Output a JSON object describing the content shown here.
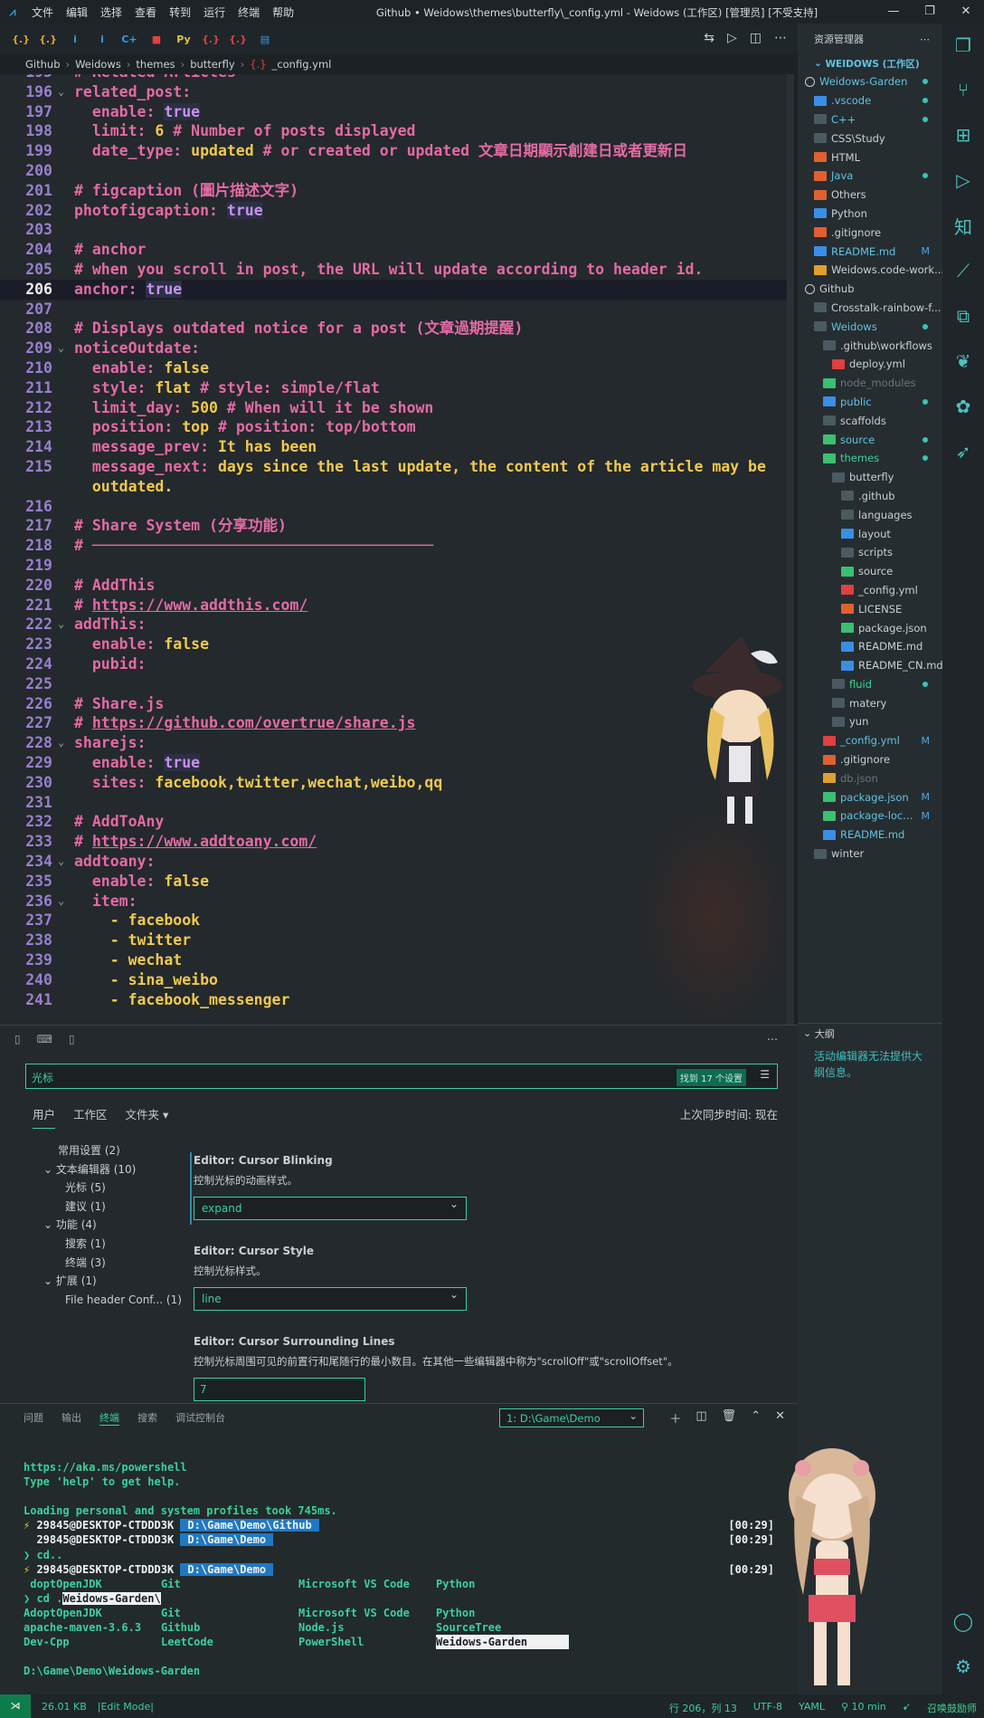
{
  "titlebar": {
    "menus": [
      "文件",
      "编辑",
      "选择",
      "查看",
      "转到",
      "运行",
      "终端",
      "帮助"
    ],
    "title": "Github • Weidows\\themes\\butterfly\\_config.yml - Weidows (工作区) [管理员] [不受支持]"
  },
  "tabs": [
    {
      "icon": "{.}",
      "color": "#e0a030"
    },
    {
      "icon": "{.}",
      "color": "#e0a030"
    },
    {
      "icon": "i",
      "color": "#3a9ae6"
    },
    {
      "icon": "i",
      "color": "#3a9ae6"
    },
    {
      "icon": "C+",
      "color": "#3a9ae6"
    },
    {
      "icon": "■",
      "color": "#e04040"
    },
    {
      "icon": "Py",
      "color": "#e0c040"
    },
    {
      "icon": "{.}",
      "color": "#e04040"
    },
    {
      "icon": "{.}",
      "color": "#e04040"
    },
    {
      "icon": "▤",
      "color": "#3a9ae6"
    }
  ],
  "breadcrumb": [
    "Github",
    "Weidows",
    "themes",
    "butterfly",
    "_config.yml"
  ],
  "editor": {
    "lines": [
      {
        "n": "195",
        "segs": [
          {
            "c": "com",
            "t": "# Related Articles"
          }
        ]
      },
      {
        "n": "196",
        "fold": true,
        "segs": [
          {
            "c": "key",
            "t": "related_post:"
          }
        ]
      },
      {
        "n": "197",
        "segs": [
          {
            "c": "key",
            "t": "  enable: "
          },
          {
            "c": "true",
            "t": "true"
          }
        ]
      },
      {
        "n": "198",
        "segs": [
          {
            "c": "key",
            "t": "  limit: "
          },
          {
            "c": "num",
            "t": "6"
          },
          {
            "c": "com",
            "t": " # Number of posts displayed"
          }
        ]
      },
      {
        "n": "199",
        "segs": [
          {
            "c": "key",
            "t": "  date_type: "
          },
          {
            "c": "val",
            "t": "updated"
          },
          {
            "c": "com",
            "t": " # or created or updated 文章日期顯示創建日或者更新日"
          }
        ]
      },
      {
        "n": "200",
        "segs": []
      },
      {
        "n": "201",
        "segs": [
          {
            "c": "com",
            "t": "# figcaption (圖片描述文字)"
          }
        ]
      },
      {
        "n": "202",
        "segs": [
          {
            "c": "key",
            "t": "photofigcaption: "
          },
          {
            "c": "true",
            "t": "true"
          }
        ]
      },
      {
        "n": "203",
        "segs": []
      },
      {
        "n": "204",
        "segs": [
          {
            "c": "com",
            "t": "# anchor"
          }
        ]
      },
      {
        "n": "205",
        "segs": [
          {
            "c": "com",
            "t": "# when you scroll in post, the URL will update according to header id."
          }
        ]
      },
      {
        "n": "206",
        "cur": true,
        "segs": [
          {
            "c": "key",
            "t": "anchor: "
          },
          {
            "c": "true",
            "t": "true"
          }
        ]
      },
      {
        "n": "207",
        "segs": []
      },
      {
        "n": "208",
        "segs": [
          {
            "c": "com",
            "t": "# Displays outdated notice for a post (文章過期提醒)"
          }
        ]
      },
      {
        "n": "209",
        "fold": true,
        "segs": [
          {
            "c": "key",
            "t": "noticeOutdate:"
          }
        ]
      },
      {
        "n": "210",
        "segs": [
          {
            "c": "key",
            "t": "  enable: "
          },
          {
            "c": "val",
            "t": "false"
          }
        ]
      },
      {
        "n": "211",
        "segs": [
          {
            "c": "key",
            "t": "  style: "
          },
          {
            "c": "val",
            "t": "flat"
          },
          {
            "c": "com",
            "t": " # style: simple/flat"
          }
        ]
      },
      {
        "n": "212",
        "segs": [
          {
            "c": "key",
            "t": "  limit_day: "
          },
          {
            "c": "num",
            "t": "500"
          },
          {
            "c": "com",
            "t": " # When will it be shown"
          }
        ]
      },
      {
        "n": "213",
        "segs": [
          {
            "c": "key",
            "t": "  position: "
          },
          {
            "c": "val",
            "t": "top"
          },
          {
            "c": "com",
            "t": " # position: top/bottom"
          }
        ]
      },
      {
        "n": "214",
        "segs": [
          {
            "c": "key",
            "t": "  message_prev: "
          },
          {
            "c": "val",
            "t": "It has been"
          }
        ]
      },
      {
        "n": "215",
        "segs": [
          {
            "c": "key",
            "t": "  message_next: "
          },
          {
            "c": "val",
            "t": "days since the last update, the content of the article may be"
          }
        ]
      },
      {
        "n": "",
        "segs": [
          {
            "c": "val",
            "t": "  outdated."
          }
        ]
      },
      {
        "n": "216",
        "segs": []
      },
      {
        "n": "217",
        "segs": [
          {
            "c": "com",
            "t": "# Share System (分享功能)"
          }
        ]
      },
      {
        "n": "218",
        "segs": [
          {
            "c": "com",
            "t": "# ──────────────────────────────────────"
          }
        ]
      },
      {
        "n": "219",
        "segs": []
      },
      {
        "n": "220",
        "segs": [
          {
            "c": "com",
            "t": "# AddThis"
          }
        ]
      },
      {
        "n": "221",
        "segs": [
          {
            "c": "com",
            "t": "# "
          },
          {
            "c": "url",
            "t": "https://www.addthis.com/"
          }
        ]
      },
      {
        "n": "222",
        "fold": true,
        "segs": [
          {
            "c": "key",
            "t": "addThis:"
          }
        ]
      },
      {
        "n": "223",
        "segs": [
          {
            "c": "key",
            "t": "  enable: "
          },
          {
            "c": "val",
            "t": "false"
          }
        ]
      },
      {
        "n": "224",
        "segs": [
          {
            "c": "key",
            "t": "  pubid:"
          }
        ]
      },
      {
        "n": "225",
        "segs": []
      },
      {
        "n": "226",
        "segs": [
          {
            "c": "com",
            "t": "# Share.js"
          }
        ]
      },
      {
        "n": "227",
        "segs": [
          {
            "c": "com",
            "t": "# "
          },
          {
            "c": "url",
            "t": "https://github.com/overtrue/share.js"
          }
        ]
      },
      {
        "n": "228",
        "fold": true,
        "segs": [
          {
            "c": "key",
            "t": "sharejs:"
          }
        ]
      },
      {
        "n": "229",
        "segs": [
          {
            "c": "key",
            "t": "  enable: "
          },
          {
            "c": "true",
            "t": "true"
          }
        ]
      },
      {
        "n": "230",
        "segs": [
          {
            "c": "key",
            "t": "  sites: "
          },
          {
            "c": "val",
            "t": "facebook,twitter,wechat,weibo,qq"
          }
        ]
      },
      {
        "n": "231",
        "segs": []
      },
      {
        "n": "232",
        "segs": [
          {
            "c": "com",
            "t": "# AddToAny"
          }
        ]
      },
      {
        "n": "233",
        "segs": [
          {
            "c": "com",
            "t": "# "
          },
          {
            "c": "url",
            "t": "https://www.addtoany.com/"
          }
        ]
      },
      {
        "n": "234",
        "fold": true,
        "segs": [
          {
            "c": "key",
            "t": "addtoany:"
          }
        ]
      },
      {
        "n": "235",
        "segs": [
          {
            "c": "key",
            "t": "  enable: "
          },
          {
            "c": "val",
            "t": "false"
          }
        ]
      },
      {
        "n": "236",
        "fold": true,
        "segs": [
          {
            "c": "key",
            "t": "  item:"
          }
        ]
      },
      {
        "n": "237",
        "segs": [
          {
            "c": "val",
            "t": "    - facebook"
          }
        ]
      },
      {
        "n": "238",
        "segs": [
          {
            "c": "val",
            "t": "    - twitter"
          }
        ]
      },
      {
        "n": "239",
        "segs": [
          {
            "c": "val",
            "t": "    - wechat"
          }
        ]
      },
      {
        "n": "240",
        "segs": [
          {
            "c": "val",
            "t": "    - sina_weibo"
          }
        ]
      },
      {
        "n": "241",
        "segs": [
          {
            "c": "val",
            "t": "    - facebook_messenger"
          }
        ]
      }
    ]
  },
  "explorer": {
    "title": "资源管理器",
    "workspace": "WEIDOWS (工作区)",
    "items": [
      {
        "label": "Weidows-Garden",
        "d": 0,
        "color": "#5fc3e4",
        "ic": "circle",
        "dot": true
      },
      {
        "label": ".vscode",
        "d": 1,
        "color": "#5fc3e4",
        "ic": "#3a8ee6",
        "dot": true
      },
      {
        "label": "C++",
        "d": 1,
        "color": "#5fc3e4",
        "ic": "#4a5a60",
        "dot": true
      },
      {
        "label": "CSS\\Study",
        "d": 1,
        "color": "#c8d0d2",
        "ic": "#4a5a60"
      },
      {
        "label": "HTML",
        "d": 1,
        "color": "#c8d0d2",
        "ic": "#e06030"
      },
      {
        "label": "Java",
        "d": 1,
        "color": "#5fc3e4",
        "ic": "#e06030",
        "dot": true
      },
      {
        "label": "Others",
        "d": 1,
        "color": "#c8d0d2",
        "ic": "#e06030"
      },
      {
        "label": "Python",
        "d": 1,
        "color": "#c8d0d2",
        "ic": "#3a8ee6"
      },
      {
        "label": ".gitignore",
        "d": 1,
        "color": "#c8d0d2",
        "ic": "#e06030"
      },
      {
        "label": "README.md",
        "d": 1,
        "color": "#5fc3e4",
        "ic": "#3a8ee6",
        "m": "M"
      },
      {
        "label": "Weidows.code-work...",
        "d": 1,
        "color": "#c8d0d2",
        "ic": "#e0a030"
      },
      {
        "label": "Github",
        "d": 0,
        "color": "#c8d0d2",
        "ic": "circle"
      },
      {
        "label": "Crosstalk-rainbow-f...",
        "d": 1,
        "color": "#c8d0d2",
        "ic": "#4a5a60"
      },
      {
        "label": "Weidows",
        "d": 1,
        "color": "#5fc3e4",
        "ic": "#4a5a60",
        "dot": true
      },
      {
        "label": ".github\\workflows",
        "d": 2,
        "color": "#c8d0d2",
        "ic": "#4a5a60"
      },
      {
        "label": "deploy.yml",
        "d": 3,
        "color": "#c8d0d2",
        "ic": "#e04040"
      },
      {
        "label": "node_modules",
        "d": 2,
        "color": "#6a7478",
        "ic": "#3ac070"
      },
      {
        "label": "public",
        "d": 2,
        "color": "#5fc3e4",
        "ic": "#3a8ee6",
        "dot": true
      },
      {
        "label": "scaffolds",
        "d": 2,
        "color": "#c8d0d2",
        "ic": "#4a5a60"
      },
      {
        "label": "source",
        "d": 2,
        "color": "#5fc3e4",
        "ic": "#3ac070",
        "dot": true
      },
      {
        "label": "themes",
        "d": 2,
        "color": "#3ad19a",
        "ic": "#3ac070",
        "dot": true
      },
      {
        "label": "butterfly",
        "d": 3,
        "color": "#c8d0d2",
        "ic": "#4a5a60"
      },
      {
        "label": ".github",
        "d": 4,
        "color": "#c8d0d2",
        "ic": "#4a5a60"
      },
      {
        "label": "languages",
        "d": 4,
        "color": "#c8d0d2",
        "ic": "#4a5a60"
      },
      {
        "label": "layout",
        "d": 4,
        "color": "#c8d0d2",
        "ic": "#3a8ee6"
      },
      {
        "label": "scripts",
        "d": 4,
        "color": "#c8d0d2",
        "ic": "#4a5a60"
      },
      {
        "label": "source",
        "d": 4,
        "color": "#c8d0d2",
        "ic": "#3ac070"
      },
      {
        "label": "_config.yml",
        "d": 4,
        "color": "#c8d0d2",
        "ic": "#e04040"
      },
      {
        "label": "LICENSE",
        "d": 4,
        "color": "#c8d0d2",
        "ic": "#e06030"
      },
      {
        "label": "package.json",
        "d": 4,
        "color": "#c8d0d2",
        "ic": "#3ac070"
      },
      {
        "label": "README.md",
        "d": 4,
        "color": "#c8d0d2",
        "ic": "#3a8ee6"
      },
      {
        "label": "README_CN.md",
        "d": 4,
        "color": "#c8d0d2",
        "ic": "#3a8ee6"
      },
      {
        "label": "fluid",
        "d": 3,
        "color": "#3ad19a",
        "ic": "#4a5a60",
        "dot": true
      },
      {
        "label": "matery",
        "d": 3,
        "color": "#c8d0d2",
        "ic": "#4a5a60"
      },
      {
        "label": "yun",
        "d": 3,
        "color": "#c8d0d2",
        "ic": "#4a5a60"
      },
      {
        "label": "_config.yml",
        "d": 2,
        "color": "#5fc3e4",
        "ic": "#e04040",
        "m": "M"
      },
      {
        "label": ".gitignore",
        "d": 2,
        "color": "#c8d0d2",
        "ic": "#e06030"
      },
      {
        "label": "db.json",
        "d": 2,
        "color": "#6a7478",
        "ic": "#e0a030"
      },
      {
        "label": "package.json",
        "d": 2,
        "color": "#5fc3e4",
        "ic": "#3ac070",
        "m": "M"
      },
      {
        "label": "package-loc...",
        "d": 2,
        "color": "#5fc3e4",
        "ic": "#3ac070",
        "m": "M"
      },
      {
        "label": "README.md",
        "d": 2,
        "color": "#5fc3e4",
        "ic": "#3a8ee6"
      },
      {
        "label": "winter",
        "d": 1,
        "color": "#c8d0d2",
        "ic": "#4a5a60"
      }
    ]
  },
  "outline": {
    "title": "大纲",
    "text": "活动编辑器无法提供大纲信息。"
  },
  "settings": {
    "search_value": "光标",
    "badge": "找到 17 个设置",
    "tabs": [
      "用户",
      "工作区",
      "文件夹"
    ],
    "sync": "上次同步时间: 现在",
    "toc": [
      {
        "t": "常用设置 (2)",
        "i": 0
      },
      {
        "t": "文本编辑器 (10)",
        "i": -1
      },
      {
        "t": "光标 (5)",
        "i": 1
      },
      {
        "t": "建议 (1)",
        "i": 1
      },
      {
        "t": "功能 (4)",
        "i": -1
      },
      {
        "t": "搜索 (1)",
        "i": 1
      },
      {
        "t": "终端 (3)",
        "i": 1
      },
      {
        "t": "扩展 (1)",
        "i": -1
      },
      {
        "t": "File header Conf... (1)",
        "i": 1
      }
    ],
    "items": [
      {
        "title": "Editor: Cursor Blinking",
        "desc": "控制光标的动画样式。",
        "value": "expand",
        "kind": "select"
      },
      {
        "title": "Editor: Cursor Style",
        "desc": "控制光标样式。",
        "value": "line",
        "kind": "select"
      },
      {
        "title": "Editor: Cursor Surrounding Lines",
        "desc": "控制光标周围可见的前置行和尾随行的最小数目。在其他一些编辑器中称为\"scrollOff\"或\"scrollOffset\"。",
        "value": "7",
        "kind": "input"
      }
    ]
  },
  "terminal": {
    "tabs": [
      "问题",
      "输出",
      "终端",
      "搜索",
      "调试控制台"
    ],
    "selector": "1: D:\\Game\\Demo",
    "lines": [
      {
        "t": "https://aka.ms/powershell"
      },
      {
        "t": "Type 'help' to get help."
      },
      {
        "t": ""
      },
      {
        "t": "Loading personal and system profiles took 745ms."
      },
      {
        "kind": "prompt",
        "arrow": "⚡",
        "user": "29845@DESKTOP-CTDDD3K",
        "path": "D:\\Game\\Demo\\Github",
        "time": "[00:29]"
      },
      {
        "kind": "prompt",
        "arrow": "",
        "user": "29845@DESKTOP-CTDDD3K",
        "path": "D:\\Game\\Demo",
        "time": "[00:29]"
      },
      {
        "t": "❯ cd.."
      },
      {
        "kind": "prompt",
        "arrow": "⚡",
        "user": "29845@DESKTOP-CTDDD3K",
        "path": "D:\\Game\\Demo",
        "time": "[00:29]"
      },
      {
        "kind": "cols",
        "c": [
          " dоptOpenJDK",
          "Git",
          "Microsoft VS Code",
          "Python"
        ]
      },
      {
        "kind": "cd",
        "pre": "❯ cd .",
        "hl": "Weidows-Garden\\"
      },
      {
        "kind": "cols",
        "c": [
          "AdoptOpenJDK",
          "Git",
          "Microsoft VS Code",
          "Python"
        ]
      },
      {
        "kind": "cols",
        "c": [
          "apache-maven-3.6.3",
          "Github",
          "Node.js",
          "SourceTree"
        ]
      },
      {
        "kind": "cols",
        "c": [
          "Dev-Cpp",
          "LeetCode",
          "PowerShell",
          "Weidows-Garden"
        ],
        "hl3": true
      },
      {
        "t": ""
      },
      {
        "t": "D:\\Game\\Demo\\Weidows-Garden"
      }
    ]
  },
  "status": {
    "size": "26.01 KB",
    "mode": "|Edit Mode|",
    "pos": "行 206，列 13",
    "enc": "UTF-8",
    "lang": "YAML",
    "time": "10 min",
    "extra": "召唤鼓励师"
  }
}
